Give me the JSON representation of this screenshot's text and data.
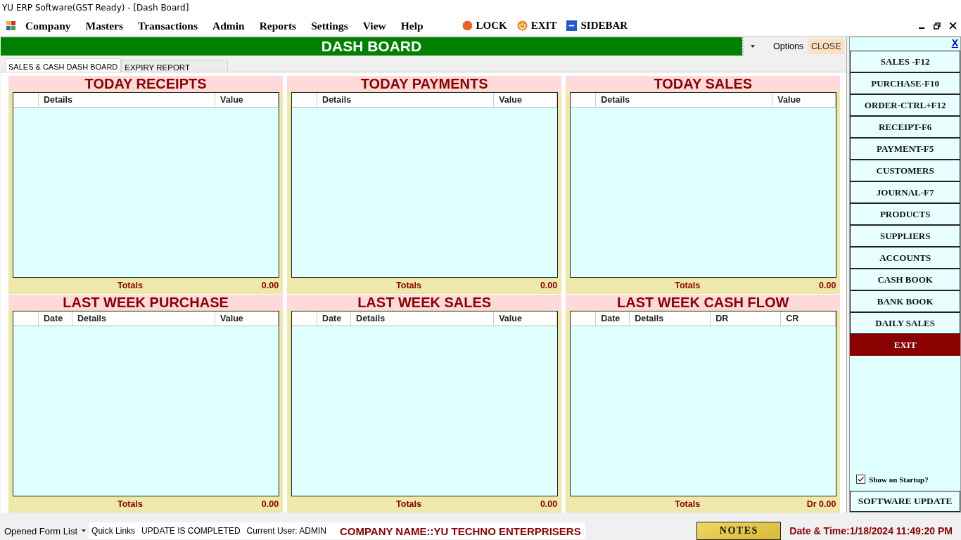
{
  "window": {
    "title": "YU ERP Software(GST Ready) - [Dash Board]"
  },
  "menu": {
    "items": [
      "Company",
      "Masters",
      "Transactions",
      "Admin",
      "Reports",
      "Settings",
      "View",
      "Help"
    ],
    "actions": [
      {
        "label": "LOCK",
        "kind": "lock"
      },
      {
        "label": "EXIT",
        "kind": "exit"
      },
      {
        "label": "SIDEBAR",
        "kind": "sidebar"
      }
    ]
  },
  "dashboard": {
    "title": "DASH BOARD",
    "options": "Options",
    "close": "CLOSE",
    "tabs": [
      {
        "label": "SALES & CASH DASH BOARD",
        "selected": true
      },
      {
        "label": "EXPIRY REPORT",
        "selected": false
      }
    ],
    "panels": [
      {
        "title": "TODAY RECEIPTS",
        "columns": [
          "Details",
          "Value"
        ],
        "totals_label": "Totals",
        "total": "0.00"
      },
      {
        "title": "TODAY PAYMENTS",
        "columns": [
          "Details",
          "Value"
        ],
        "totals_label": "Totals",
        "total": "0.00"
      },
      {
        "title": "TODAY SALES",
        "columns": [
          "Details",
          "Value"
        ],
        "totals_label": "Totals",
        "total": "0.00"
      },
      {
        "title": "LAST WEEK PURCHASE",
        "columns": [
          "Date",
          "Details",
          "Value"
        ],
        "totals_label": "Totals",
        "total": "0.00"
      },
      {
        "title": "LAST WEEK SALES",
        "columns": [
          "Date",
          "Details",
          "Value"
        ],
        "totals_label": "Totals",
        "total": "0.00"
      },
      {
        "title": "LAST WEEK CASH FLOW",
        "columns": [
          "Date",
          "Details",
          "DR",
          "CR"
        ],
        "totals_label": "Totals",
        "total": "Dr 0.00"
      }
    ]
  },
  "sidebar": {
    "close": "X",
    "buttons": [
      {
        "label": "SALES -F12",
        "kind": "normal"
      },
      {
        "label": "PURCHASE-F10",
        "kind": "normal"
      },
      {
        "label": "ORDER-CTRL+F12",
        "kind": "normal"
      },
      {
        "label": "RECEIPT-F6",
        "kind": "normal"
      },
      {
        "label": "PAYMENT-F5",
        "kind": "normal"
      },
      {
        "label": "CUSTOMERS",
        "kind": "normal"
      },
      {
        "label": "JOURNAL-F7",
        "kind": "normal"
      },
      {
        "label": "PRODUCTS",
        "kind": "normal"
      },
      {
        "label": "SUPPLIERS",
        "kind": "normal"
      },
      {
        "label": "ACCOUNTS",
        "kind": "normal"
      },
      {
        "label": "CASH BOOK",
        "kind": "normal"
      },
      {
        "label": "BANK BOOK",
        "kind": "normal"
      },
      {
        "label": "DAILY SALES",
        "kind": "normal"
      },
      {
        "label": "EXIT",
        "kind": "exit"
      }
    ],
    "checkbox": {
      "label": "Show on Startup?",
      "checked": true
    },
    "update_button": "SOFTWARE UPDATE"
  },
  "status_bar": {
    "forms": "Opened Form List",
    "quick_links": "Quick Links",
    "update": "UPDATE IS COMPLETED",
    "user": "Current User: ADMIN",
    "company": "COMPANY NAME::YU TECHNO ENTERPRISERS",
    "notes": "NOTES",
    "datetime": "Date & Time:1/18/2024 11:49:20 PM"
  }
}
